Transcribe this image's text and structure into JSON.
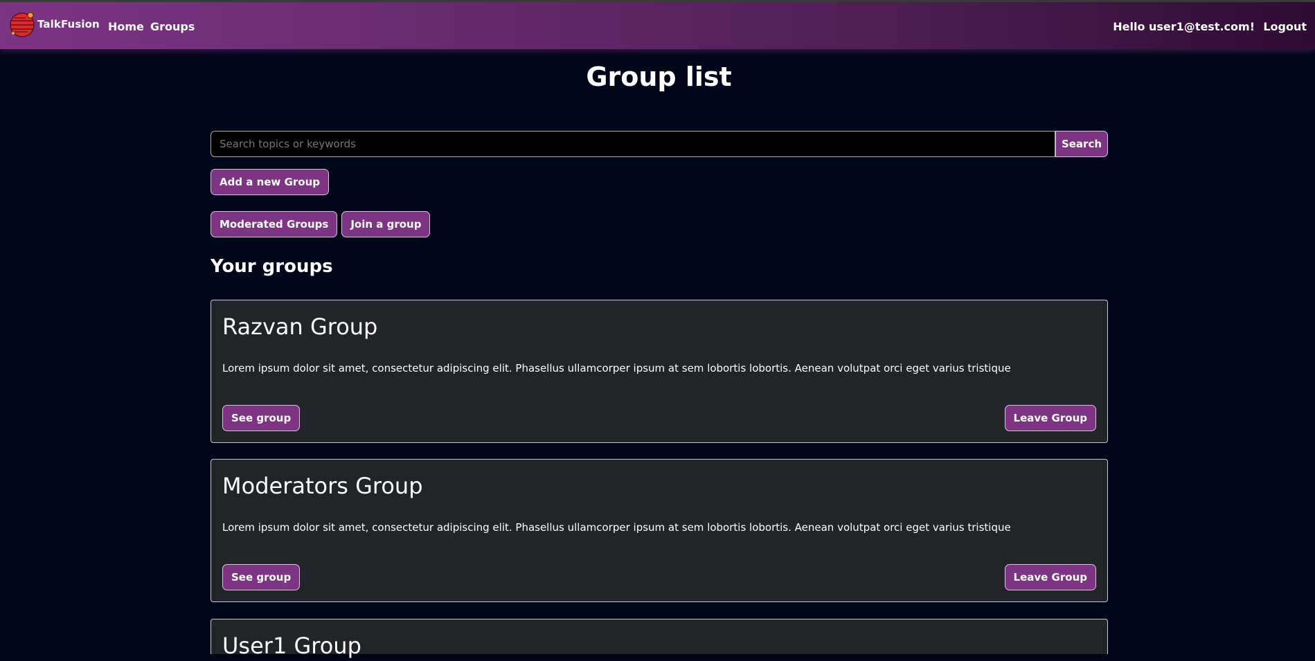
{
  "header": {
    "brand": "TalkFusion",
    "nav": {
      "home": "Home",
      "groups": "Groups"
    },
    "greeting": "Hello user1@test.com!",
    "logout": "Logout"
  },
  "page_title": "Group list",
  "search": {
    "placeholder": "Search topics or keywords",
    "value": "",
    "button": "Search"
  },
  "add_group_button": "Add a new Group",
  "filters": {
    "moderated": "Moderated Groups",
    "join": "Join a group"
  },
  "section_title": "Your groups",
  "groups": [
    {
      "name": "Razvan Group",
      "description": "Lorem ipsum dolor sit amet, consectetur adipiscing elit. Phasellus ullamcorper ipsum at sem lobortis lobortis. Aenean volutpat orci eget varius tristique",
      "see_label": "See group",
      "leave_label": "Leave Group"
    },
    {
      "name": "Moderators Group",
      "description": "Lorem ipsum dolor sit amet, consectetur adipiscing elit. Phasellus ullamcorper ipsum at sem lobortis lobortis. Aenean volutpat orci eget varius tristique",
      "see_label": "See group",
      "leave_label": "Leave Group"
    },
    {
      "name": "User1 Group"
    }
  ],
  "colors": {
    "background": "#000619",
    "accent": "#7d3483",
    "card_background": "#212429"
  }
}
